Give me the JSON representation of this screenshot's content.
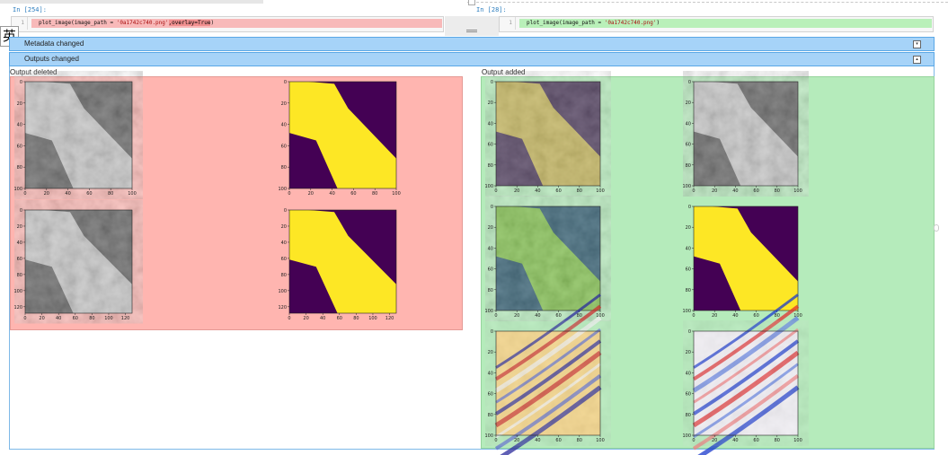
{
  "ime_indicator": "英",
  "left": {
    "prompt": "In [254]:",
    "line_number": "1",
    "code_prefix": "plot_image(image_path = ",
    "code_string": "'0a1742c740.png'",
    "code_added": ",overlay=True",
    "code_suffix": ")"
  },
  "right": {
    "prompt": "In [28]:",
    "line_number": "1",
    "code_prefix": "plot_image(image_path = ",
    "code_string": "'0a1742c740.png'",
    "code_suffix": ")"
  },
  "metadata_bar": {
    "label": "Metadata changed",
    "toggle": "▾"
  },
  "outputs_bar": {
    "label": "Outputs changed",
    "toggle": "▴"
  },
  "output_deleted_label": "Output deleted",
  "output_added_label": "Output added",
  "colors": {
    "deleted_bg": "#ffb5b0",
    "added_bg": "#b5ebbb",
    "bar_bg": "#a6d3f8",
    "prompt": "#2f7fbf",
    "viridis_yellow": "#fde725",
    "viridis_purple": "#440154"
  },
  "plots": {
    "axis_100": {
      "xticks": [
        "0",
        "20",
        "40",
        "60",
        "80",
        "100"
      ],
      "yticks": [
        "0",
        "20",
        "40",
        "60",
        "80",
        "100"
      ]
    },
    "axis_125": {
      "xticks": [
        "0",
        "20",
        "40",
        "60",
        "80",
        "100",
        "120"
      ],
      "yticks": [
        "0",
        "20",
        "40",
        "60",
        "80",
        "100",
        "120"
      ]
    }
  }
}
